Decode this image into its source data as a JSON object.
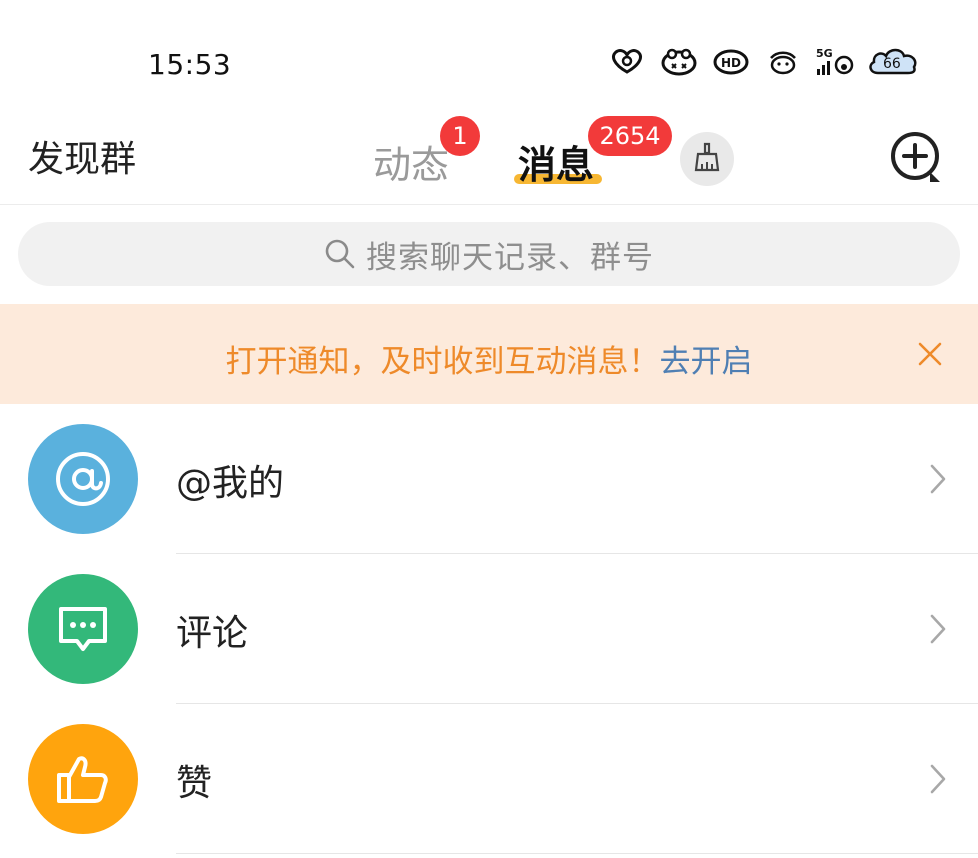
{
  "status_bar": {
    "time": "15:53",
    "network_label": "5G",
    "battery_level_text": "66"
  },
  "nav": {
    "discover_label": "发现群",
    "tabs": [
      {
        "label": "动态",
        "badge": "1",
        "active": false
      },
      {
        "label": "消息",
        "badge": "2654",
        "active": true
      }
    ],
    "clean_icon": "broom-icon",
    "compose_icon": "chat-plus-icon"
  },
  "search": {
    "placeholder": "搜索聊天记录、群号",
    "icon": "search-icon"
  },
  "notice": {
    "message": "打开通知，及时收到互动消息！",
    "link": "去开启",
    "close_icon": "close-icon"
  },
  "list": [
    {
      "label": "@我的",
      "icon": "at-icon",
      "color": "#5ab1dd"
    },
    {
      "label": "评论",
      "icon": "comment-icon",
      "color": "#33b87a"
    },
    {
      "label": "赞",
      "icon": "thumbs-up-icon",
      "color": "#ffa40d"
    }
  ],
  "colors": {
    "badge": "#f23a3a",
    "tab_underline": "#f7b733",
    "notice_bg": "#fdeadb",
    "notice_text": "#ee8a2a",
    "notice_link": "#4f7fb3"
  }
}
